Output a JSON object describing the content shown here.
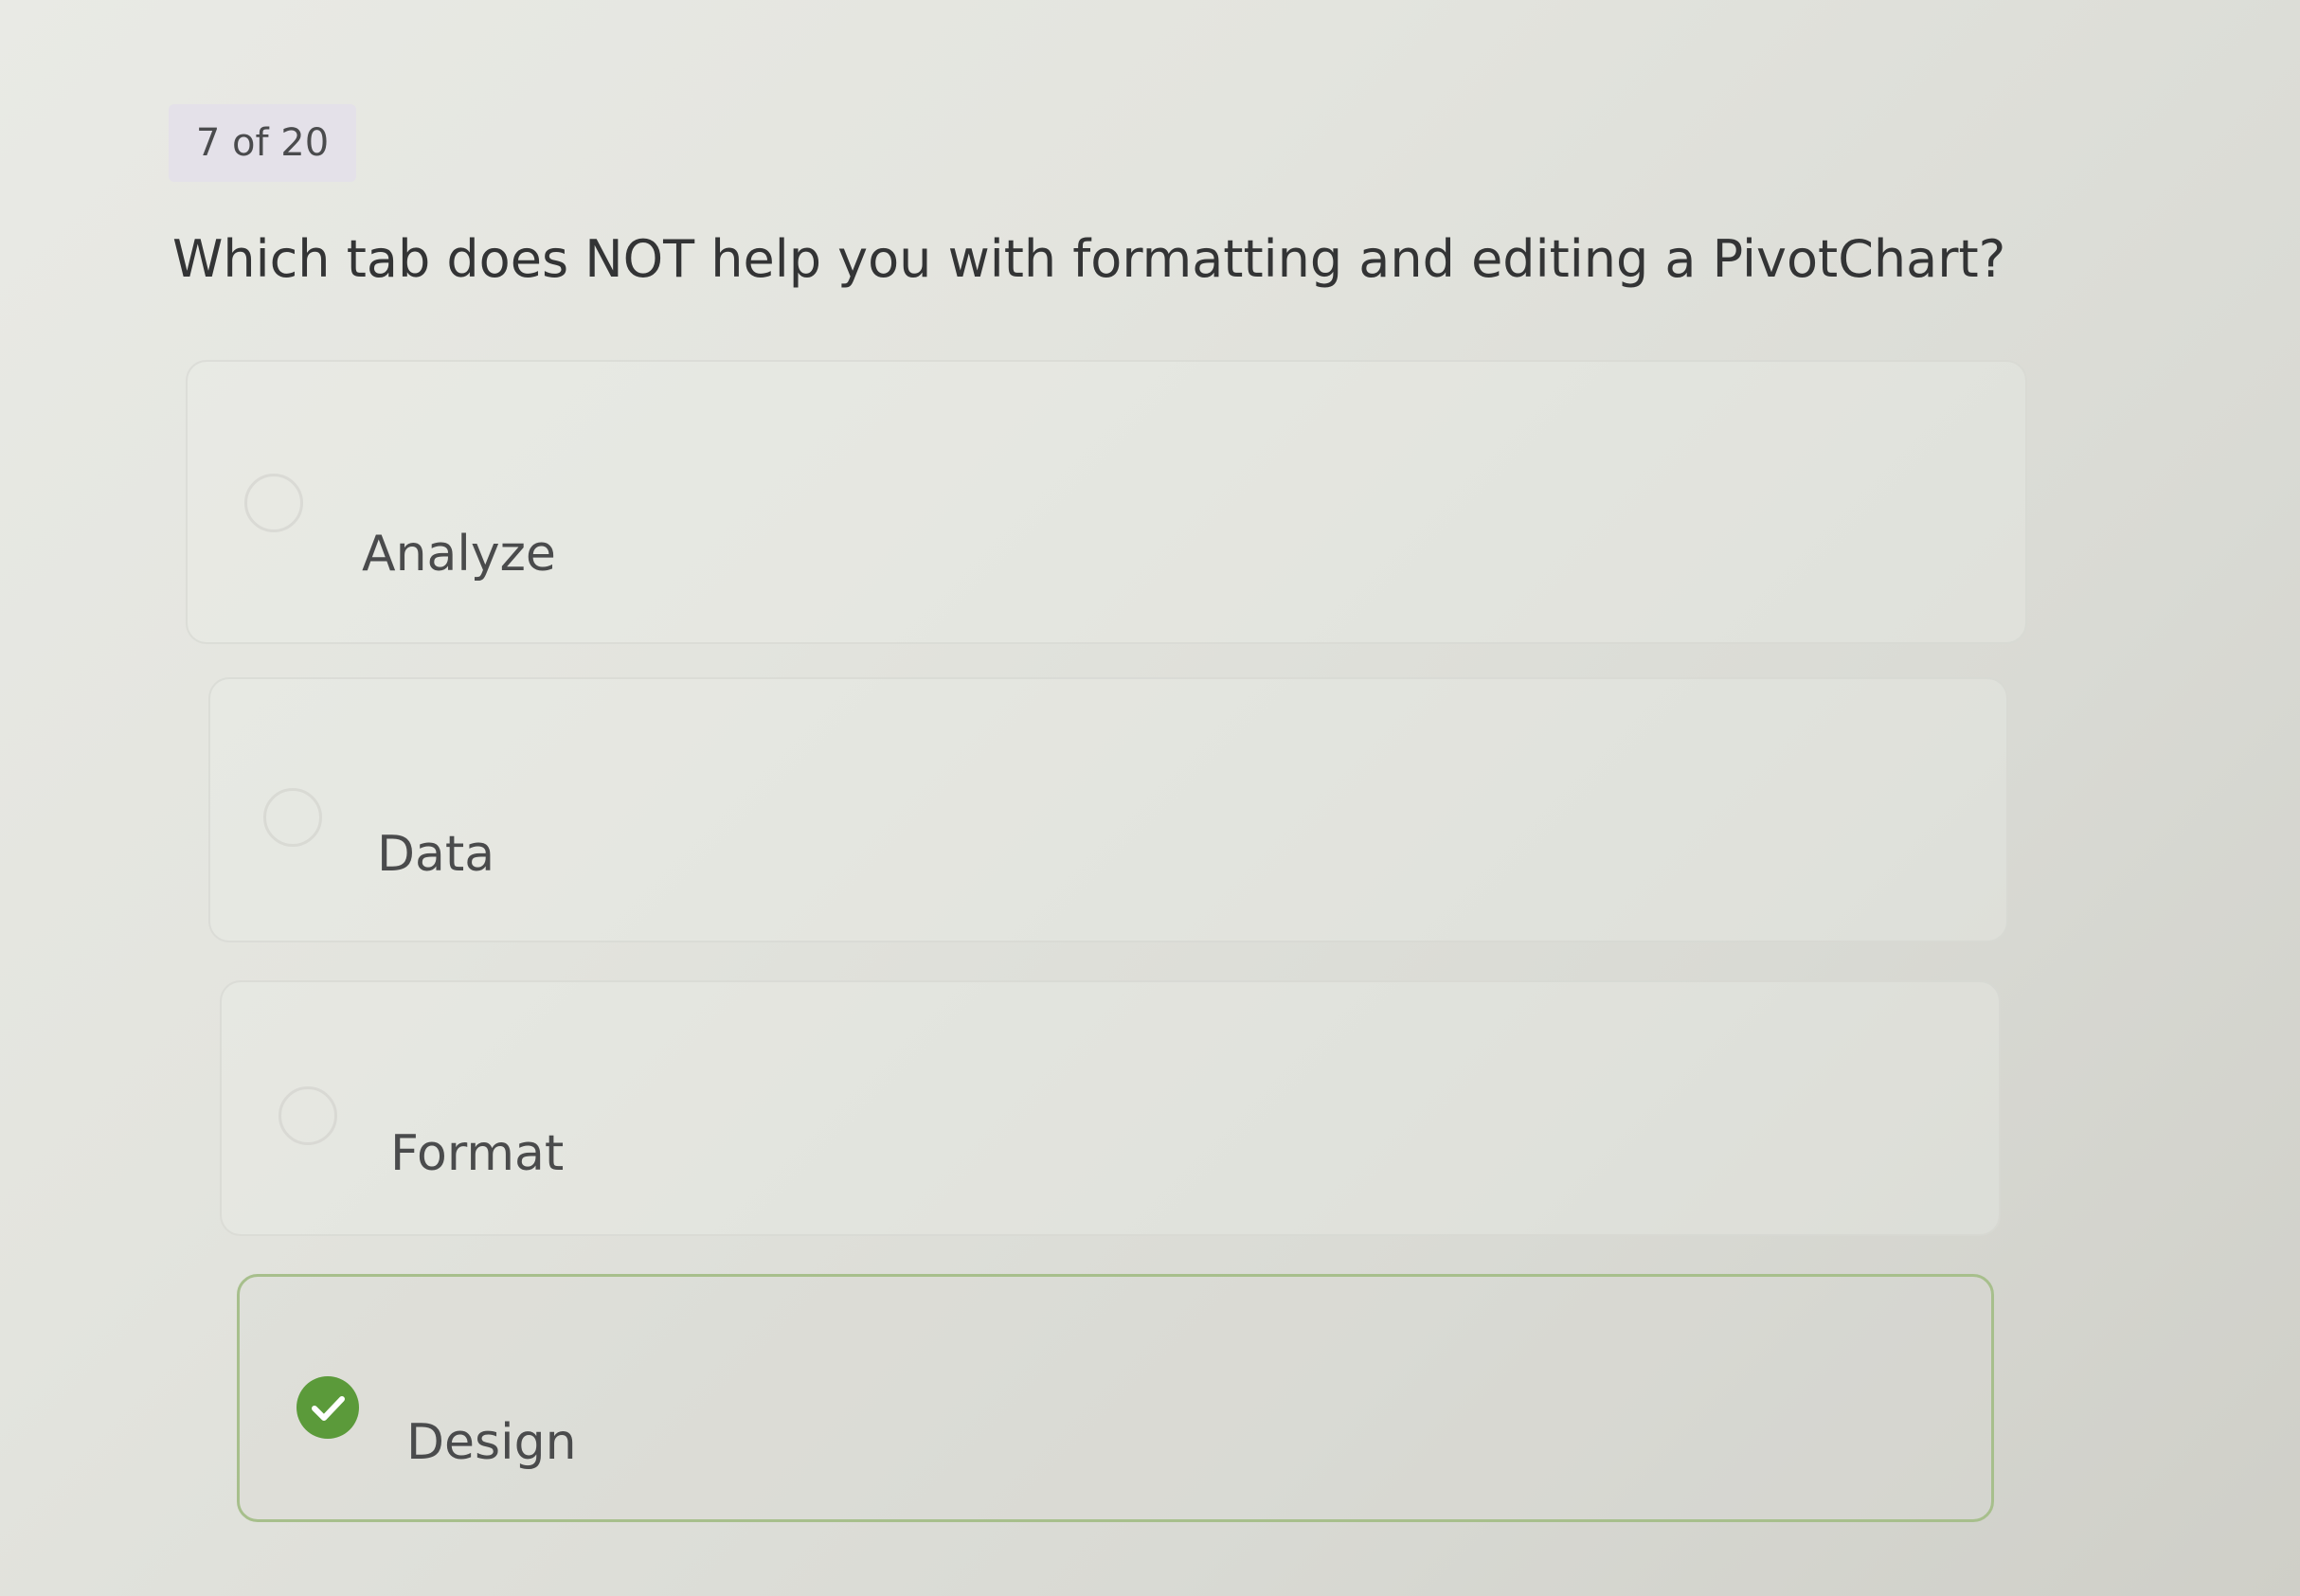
{
  "quiz": {
    "progress": "7 of 20",
    "question": "Which tab does NOT help you with formatting and editing a PivotChart?",
    "options": [
      {
        "label": "Analyze",
        "selected": false
      },
      {
        "label": "Data",
        "selected": false
      },
      {
        "label": "Format",
        "selected": false
      },
      {
        "label": "Design",
        "selected": true
      }
    ]
  },
  "colors": {
    "selected_border": "#a7bf8c",
    "check_fill": "#5b9a3a",
    "counter_bg": "#e4e1e9"
  }
}
